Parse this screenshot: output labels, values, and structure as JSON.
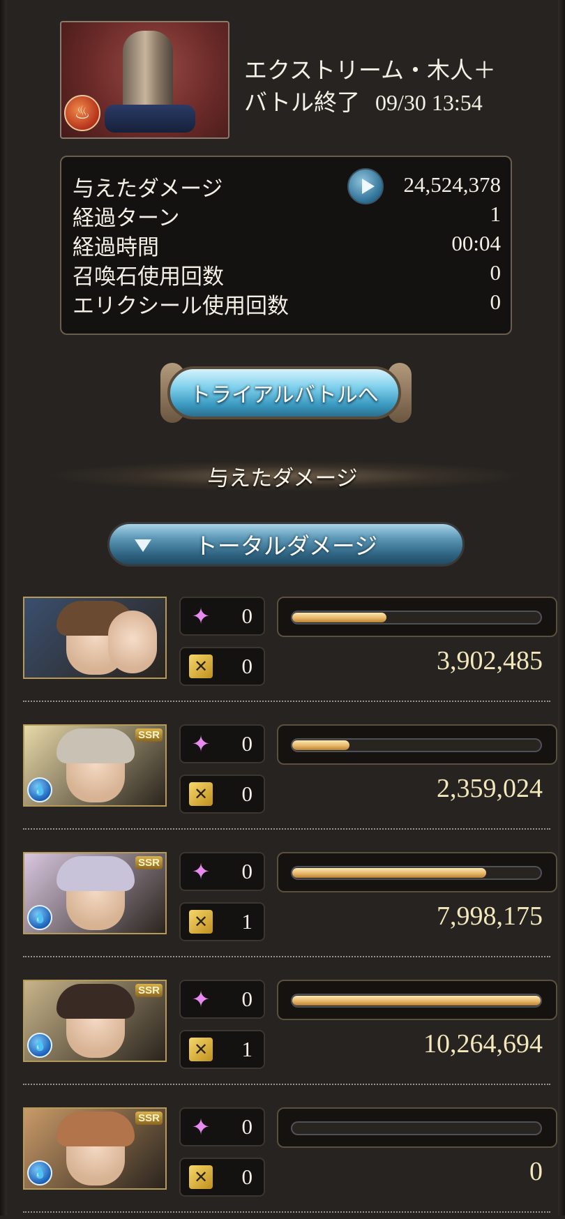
{
  "header": {
    "boss_name": "エクストリーム・木人＋",
    "status": "バトル終了",
    "datetime": "09/30 13:54"
  },
  "stats": {
    "rows": [
      {
        "label": "与えたダメージ",
        "value": "24,524,378"
      },
      {
        "label": "経過ターン",
        "value": "1"
      },
      {
        "label": "経過時間",
        "value": "00:04"
      },
      {
        "label": "召喚石使用回数",
        "value": "0"
      },
      {
        "label": "エリクシール使用回数",
        "value": "0"
      }
    ]
  },
  "trial_button": {
    "label": "トライアルバトルへ"
  },
  "section": {
    "title": "与えたダメージ"
  },
  "dropdown": {
    "selected": "トータルダメージ"
  },
  "characters": [
    {
      "skill_count": "0",
      "ca_count": "0",
      "damage": "3,902,485",
      "bar_fraction": 0.38,
      "ssr": "",
      "element": ""
    },
    {
      "skill_count": "0",
      "ca_count": "0",
      "damage": "2,359,024",
      "bar_fraction": 0.23,
      "ssr": "SSR",
      "element": "water"
    },
    {
      "skill_count": "0",
      "ca_count": "1",
      "damage": "7,998,175",
      "bar_fraction": 0.78,
      "ssr": "SSR",
      "element": "water"
    },
    {
      "skill_count": "0",
      "ca_count": "1",
      "damage": "10,264,694",
      "bar_fraction": 1.0,
      "ssr": "SSR",
      "element": "water"
    },
    {
      "skill_count": "0",
      "ca_count": "0",
      "damage": "0",
      "bar_fraction": 0.0,
      "ssr": "SSR",
      "element": "water"
    }
  ],
  "colors": {
    "accent_bar": "#e7b768",
    "panel_bg": "#141210",
    "page_bg": "#262320"
  }
}
